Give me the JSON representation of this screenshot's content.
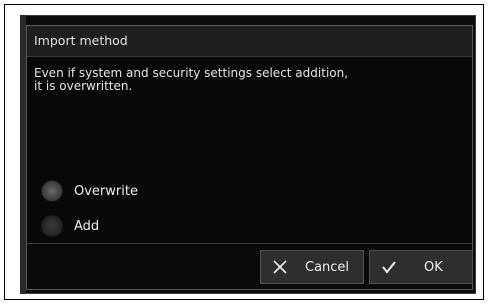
{
  "dialog": {
    "title": "Import method",
    "message": "Even if system and security settings select addition,\nit is overwritten.",
    "options": [
      {
        "label": "Overwrite"
      },
      {
        "label": "Add"
      }
    ],
    "buttons": {
      "cancel_label": "Cancel",
      "ok_label": "OK"
    }
  },
  "icons": {
    "cancel": "close-icon",
    "ok": "checkmark-icon"
  }
}
